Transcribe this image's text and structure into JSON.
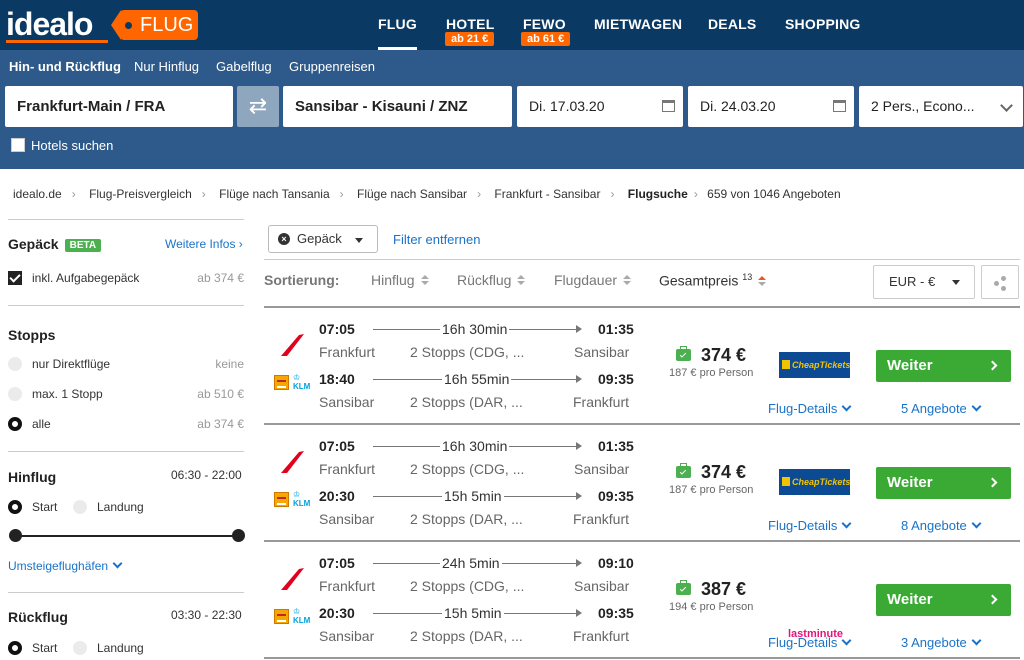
{
  "header": {
    "logo": "idealo",
    "tag": "FLUG",
    "nav": [
      {
        "label": "FLUG",
        "badge": ""
      },
      {
        "label": "HOTEL",
        "badge": "ab 21 €"
      },
      {
        "label": "FEWO",
        "badge": "ab 61 €"
      },
      {
        "label": "MIETWAGEN",
        "badge": ""
      },
      {
        "label": "DEALS",
        "badge": ""
      },
      {
        "label": "SHOPPING",
        "badge": ""
      }
    ]
  },
  "search": {
    "trip_types": [
      "Hin- und Rückflug",
      "Nur Hinflug",
      "Gabelflug",
      "Gruppenreisen"
    ],
    "origin": "Frankfurt-Main / FRA",
    "destination": "Sansibar - Kisauni / ZNZ",
    "depart_date": "Di. 17.03.20",
    "return_date": "Di. 24.03.20",
    "passengers": "2 Pers., Econo...",
    "hotels_label": "Hotels suchen"
  },
  "breadcrumb": [
    "idealo.de",
    "Flug-Preisvergleich",
    "Flüge nach Tansania",
    "Flüge nach Sansibar",
    "Frankfurt - Sansibar",
    "Flugsuche"
  ],
  "result_count": "659 von 1046 Angeboten",
  "sidebar": {
    "luggage": {
      "title": "Gepäck",
      "badge": "BETA",
      "more": "Weitere Infos ›",
      "option": "inkl. Aufgabegepäck",
      "price": "ab 374 €"
    },
    "stops": {
      "title": "Stopps",
      "options": [
        {
          "label": "nur Direktflüge",
          "price": "keine"
        },
        {
          "label": "max. 1 Stopp",
          "price": "ab 510 €"
        },
        {
          "label": "alle",
          "price": "ab 374 €"
        }
      ]
    },
    "outbound": {
      "title": "Hinflug",
      "range": "06:30 - 22:00",
      "start": "Start",
      "landing": "Landung"
    },
    "layover_link": "Umsteigeflughäfen",
    "return": {
      "title": "Rückflug",
      "range": "03:30 - 22:30",
      "start": "Start",
      "landing": "Landung"
    }
  },
  "filters": {
    "pill": "Gepäck",
    "clear": "Filter entfernen"
  },
  "sort": {
    "label": "Sortierung:",
    "options": [
      "Hinflug",
      "Rückflug",
      "Flugdauer",
      "Gesamtpreis"
    ],
    "footnote": "13",
    "currency": "EUR - €"
  },
  "results": [
    {
      "out": {
        "dep": "07:05",
        "from": "Frankfurt",
        "dur": "16h 30min",
        "stops": "2 Stopps (CDG, ...",
        "arr": "01:35",
        "to": "Sansibar"
      },
      "ret": {
        "dep": "18:40",
        "from": "Sansibar",
        "dur": "16h 55min",
        "stops": "2 Stopps (DAR, ...",
        "arr": "09:35",
        "to": "Frankfurt"
      },
      "price": "374 €",
      "per_person": "187 € pro Person",
      "provider": "CheapTickets",
      "cta": "Weiter",
      "details": "Flug-Details",
      "offers": "5 Angebote"
    },
    {
      "out": {
        "dep": "07:05",
        "from": "Frankfurt",
        "dur": "16h 30min",
        "stops": "2 Stopps (CDG, ...",
        "arr": "01:35",
        "to": "Sansibar"
      },
      "ret": {
        "dep": "20:30",
        "from": "Sansibar",
        "dur": "15h 5min",
        "stops": "2 Stopps (DAR, ...",
        "arr": "09:35",
        "to": "Frankfurt"
      },
      "price": "374 €",
      "per_person": "187 € pro Person",
      "provider": "CheapTickets",
      "cta": "Weiter",
      "details": "Flug-Details",
      "offers": "8 Angebote"
    },
    {
      "out": {
        "dep": "07:05",
        "from": "Frankfurt",
        "dur": "24h 5min",
        "stops": "2 Stopps (CDG, ...",
        "arr": "09:10",
        "to": "Sansibar"
      },
      "ret": {
        "dep": "20:30",
        "from": "Sansibar",
        "dur": "15h 5min",
        "stops": "2 Stopps (DAR, ...",
        "arr": "09:35",
        "to": "Frankfurt"
      },
      "price": "387 €",
      "per_person": "194 € pro Person",
      "provider": "lastminute",
      "cta": "Weiter",
      "details": "Flug-Details",
      "offers": "3 Angebote"
    }
  ],
  "colors": {
    "header_bg": "#0a3a64",
    "search_bg": "#2d5a8a",
    "accent_orange": "#ff6600",
    "cta_green": "#3aaa35",
    "link_blue": "#1a73c8"
  }
}
